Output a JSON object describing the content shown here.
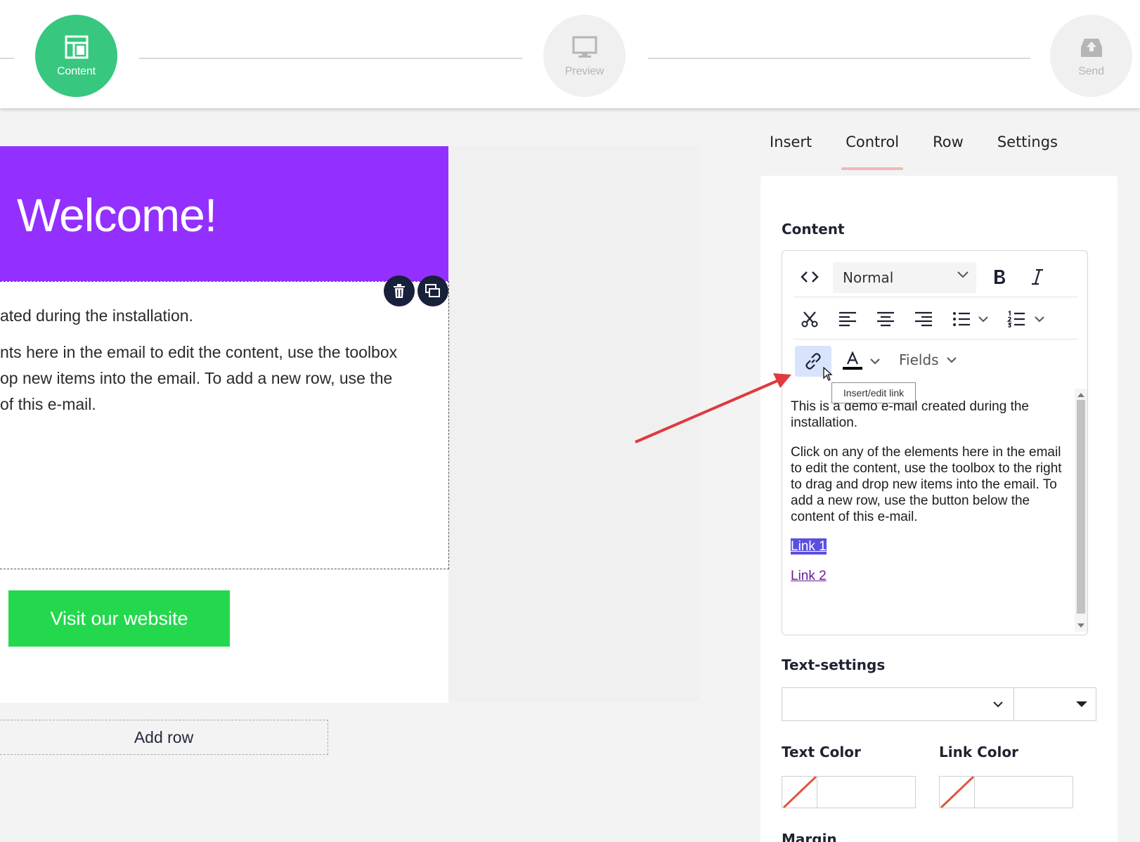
{
  "stepper": {
    "steps": [
      {
        "label": "Content",
        "icon": "layout-icon",
        "state": "active"
      },
      {
        "label": "Preview",
        "icon": "monitor-icon",
        "state": "inactive"
      },
      {
        "label": "Send",
        "icon": "send-upload-icon",
        "state": "inactive"
      }
    ],
    "active_color": "#37c77f"
  },
  "email": {
    "header_title": "Welcome!",
    "header_color": "#9330ff",
    "body_lines": [
      "ated during the installation.",
      "nts here in the email to edit the content, use the toolbox",
      "op new items into the email. To add a new row, use the",
      "of this e-mail."
    ],
    "button_label": "Visit our website",
    "button_color": "#24d84e",
    "add_row_label": "Add row"
  },
  "panel": {
    "tabs": [
      {
        "label": "Insert",
        "active": false
      },
      {
        "label": "Control",
        "active": true
      },
      {
        "label": "Row",
        "active": false
      },
      {
        "label": "Settings",
        "active": false
      }
    ],
    "content_label": "Content",
    "toolbar": {
      "format_value": "Normal",
      "fields_label": "Fields",
      "tooltip": "Insert/edit link"
    },
    "editor": {
      "paragraph1": "This is a demo e-mail created during the installation.",
      "paragraph2": "Click on any of the elements here in the email to edit the content, use the toolbox to the right to drag and drop new items into the email. To add a new row, use the button below the content of this e-mail.",
      "link1": "Link 1",
      "link2": "Link 2"
    },
    "text_settings_label": "Text-settings",
    "text_color_label": "Text Color",
    "link_color_label": "Link Color",
    "margin_label": "Margin"
  }
}
